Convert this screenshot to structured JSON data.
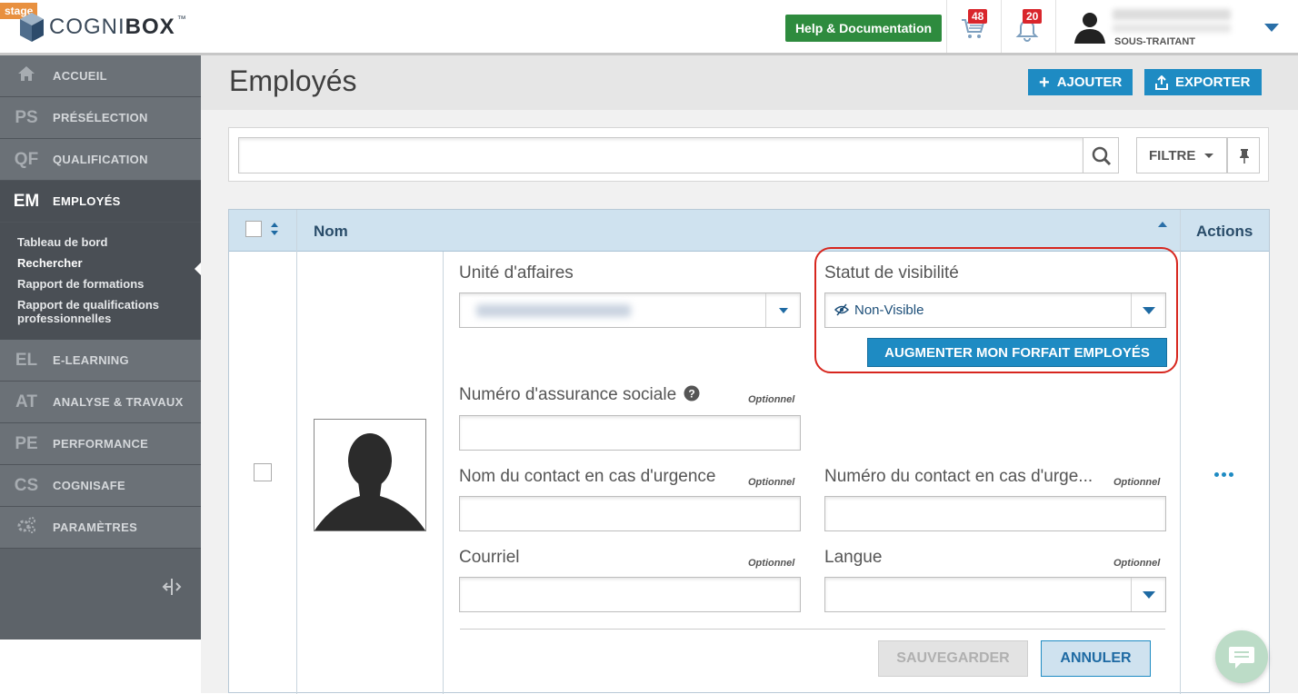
{
  "header": {
    "stage_tag": "stage",
    "logo_text_light": "COGNI",
    "logo_text_bold": "BOX",
    "logo_tm": "™",
    "help_button": "Help & Documentation",
    "cart_count": "48",
    "bell_count": "20",
    "user_role": "SOUS-TRAITANT"
  },
  "sidebar": {
    "items": [
      {
        "abbr": "⌂",
        "label": "ACCUEIL"
      },
      {
        "abbr": "PS",
        "label": "PRÉSÉLECTION"
      },
      {
        "abbr": "QF",
        "label": "QUALIFICATION"
      },
      {
        "abbr": "EM",
        "label": "EMPLOYÉS"
      },
      {
        "abbr": "EL",
        "label": "E-LEARNING"
      },
      {
        "abbr": "AT",
        "label": "ANALYSE & TRAVAUX"
      },
      {
        "abbr": "PE",
        "label": "PERFORMANCE"
      },
      {
        "abbr": "CS",
        "label": "COGNISAFE"
      },
      {
        "abbr": "⚙",
        "label": "PARAMÈTRES"
      }
    ],
    "subitems": [
      "Tableau de bord",
      "Rechercher",
      "Rapport de formations",
      "Rapport de qualifications professionnelles"
    ]
  },
  "page": {
    "title": "Employés",
    "add_button": "AJOUTER",
    "export_button": "EXPORTER",
    "filter_button": "FILTRE"
  },
  "table": {
    "col_name": "Nom",
    "col_actions": "Actions"
  },
  "form": {
    "business_unit_label": "Unité d'affaires",
    "visibility_label": "Statut de visibilité",
    "visibility_value": "Non-Visible",
    "upgrade_button": "AUGMENTER MON FORFAIT EMPLOYÉS",
    "sin_label": "Numéro d'assurance sociale",
    "optional": "Optionnel",
    "emergency_name_label": "Nom du contact en cas d'urgence",
    "emergency_number_label": "Numéro du contact en cas d'urge...",
    "email_label": "Courriel",
    "language_label": "Langue",
    "save_button": "SAUVEGARDER",
    "cancel_button": "ANNULER"
  }
}
